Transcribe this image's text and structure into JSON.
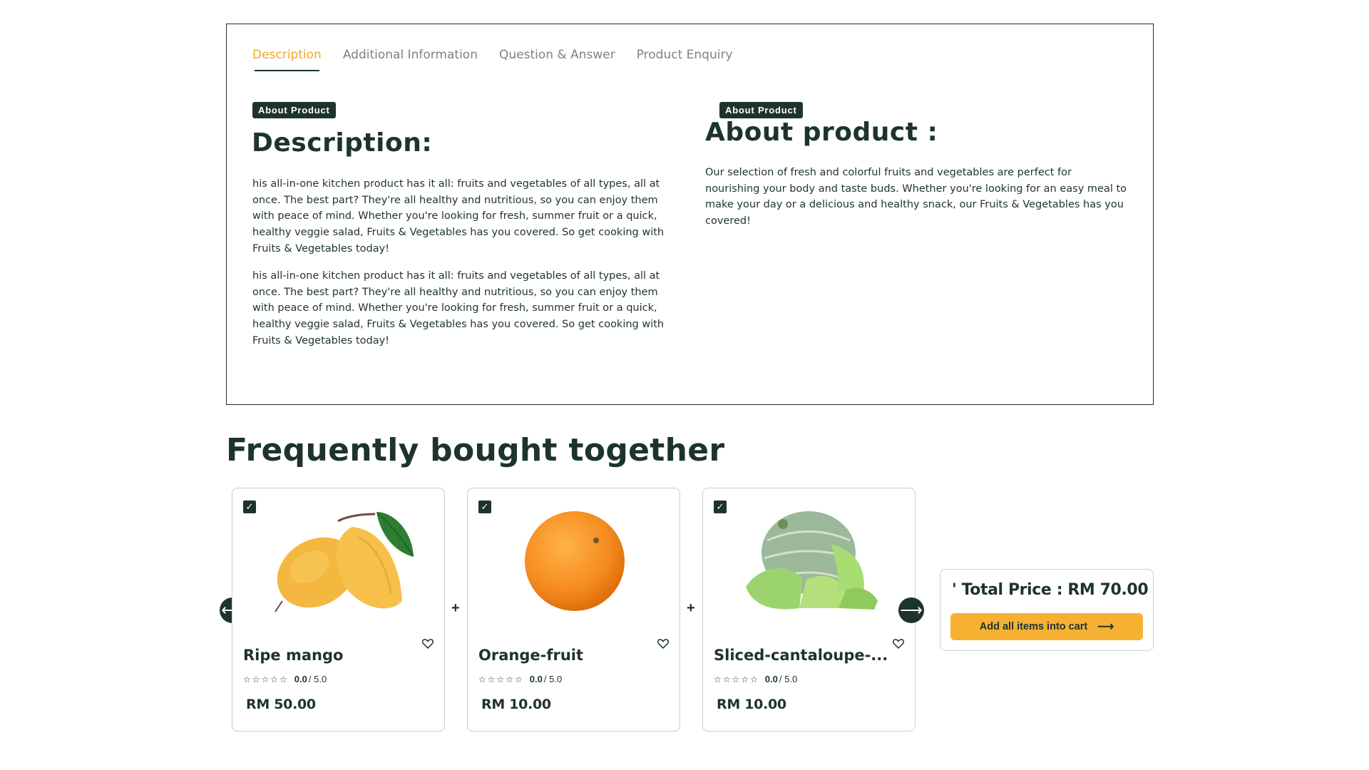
{
  "tabs": [
    {
      "label": "Description"
    },
    {
      "label": "Additional Information"
    },
    {
      "label": "Question & Answer"
    },
    {
      "label": "Product Enquiry"
    }
  ],
  "description": {
    "badge": "About Product",
    "heading": "Description:",
    "paragraphs": [
      "his all-in-one kitchen product has it all: fruits and vegetables of all types, all at once. The best part? They're all healthy and nutritious, so you can enjoy them with peace of mind. Whether you're looking for fresh, summer fruit or a quick, healthy veggie salad, Fruits & Vegetables has you covered. So get cooking with Fruits & Vegetables today!",
      "his all-in-one kitchen product has it all: fruits and vegetables of all types, all at once. The best part? They're all healthy and nutritious, so you can enjoy them with peace of mind. Whether you're looking for fresh, summer fruit or a quick, healthy veggie salad, Fruits & Vegetables has you covered. So get cooking with Fruits & Vegetables today!"
    ]
  },
  "about": {
    "badge": "About Product",
    "heading": "About product :",
    "paragraph": "Our selection of fresh and colorful fruits and vegetables are perfect for nourishing your body and taste buds. Whether you're looking for an easy meal to make your day or a delicious and healthy snack, our Fruits & Vegetables has you covered!"
  },
  "fbt": {
    "title": "Frequently bought together",
    "products": [
      {
        "name": "Ripe mango",
        "rating": "0.0",
        "rating_max": "/ 5.0",
        "price": "RM 50.00",
        "image_icon": "mango-image"
      },
      {
        "name": "Orange-fruit",
        "rating": "0.0",
        "rating_max": "/ 5.0",
        "price": "RM 10.00",
        "image_icon": "orange-image"
      },
      {
        "name": "Sliced-cantaloupe-...",
        "rating": "0.0",
        "rating_max": "/ 5.0",
        "price": "RM 10.00",
        "image_icon": "cantaloupe-image"
      }
    ],
    "plus_sign": "+",
    "check_mark": "✓",
    "stars": "☆☆☆☆☆",
    "total_label": "' Total Price : RM 70.00",
    "add_all_label": "Add all items into cart",
    "add_arrow": "⟶",
    "prev_arrow": "⟵",
    "next_arrow": "⟶"
  },
  "colors": {
    "accent": "#f5a623",
    "dark": "#1d3330",
    "button": "#f6b133",
    "muted_tab": "#7a8584"
  }
}
